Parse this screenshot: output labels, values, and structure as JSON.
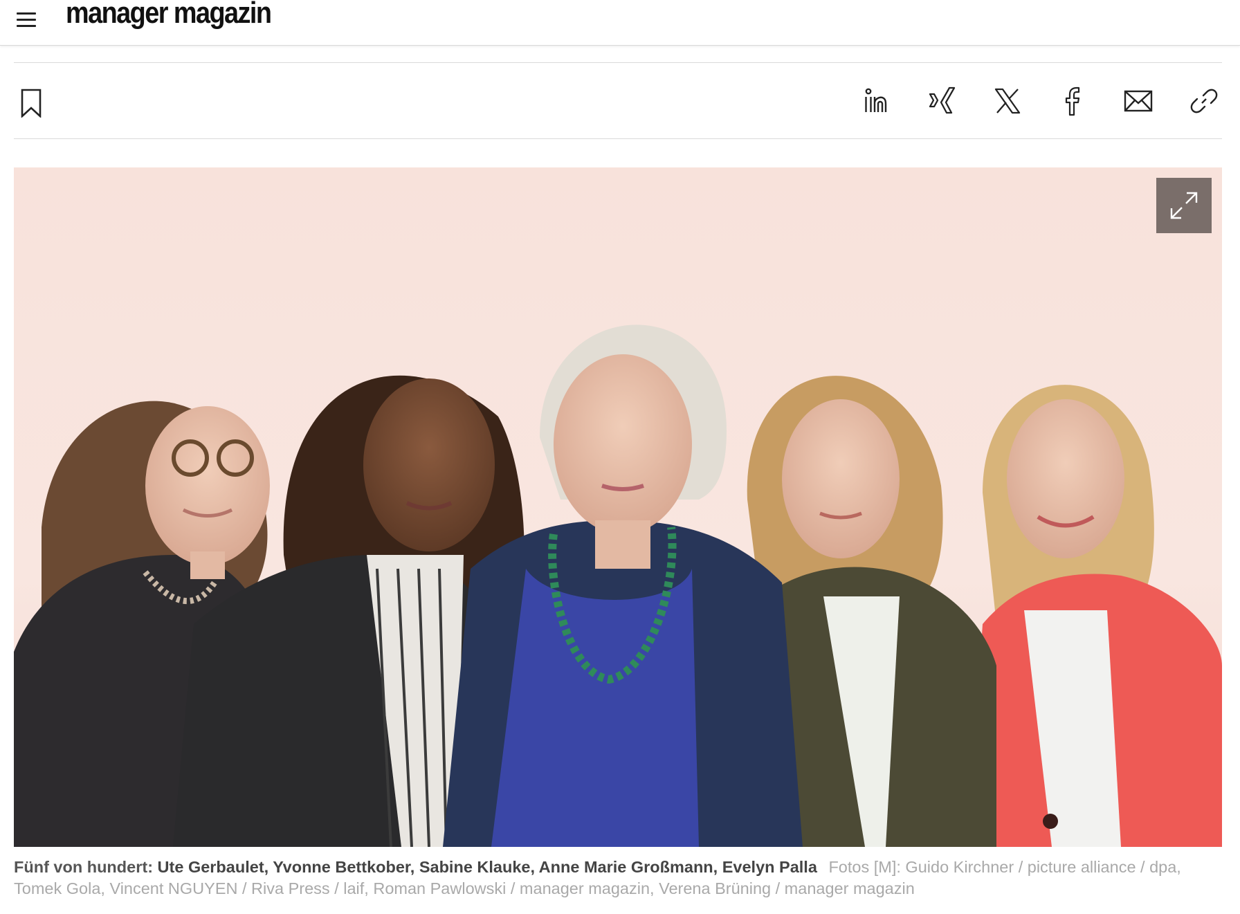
{
  "header": {
    "brand": "manager magazin",
    "menu_icon": "hamburger-menu-icon"
  },
  "actions": {
    "bookmark_icon": "bookmark-icon",
    "share_icons": [
      "linkedin-icon",
      "xing-icon",
      "x-icon",
      "facebook-icon",
      "mail-icon",
      "link-icon"
    ]
  },
  "figure": {
    "expand_icon": "expand-icon",
    "background_color": "#f8e2db",
    "expand_button_color": "#7a6e6a"
  },
  "caption": {
    "lead": "Fünf von hundert",
    "separator": ":",
    "names": "Ute Gerbaulet, Yvonne Bettkober, Sabine Klauke, Anne Marie Großmann, Evelyn Palla",
    "credit": "Fotos [M]: Guido Kirchner / picture alliance / dpa, Tomek Gola, Vincent NGUYEN / Riva Press / laif, Roman Pawlowski / manager magazin, Verena Brüning / manager magazin"
  }
}
